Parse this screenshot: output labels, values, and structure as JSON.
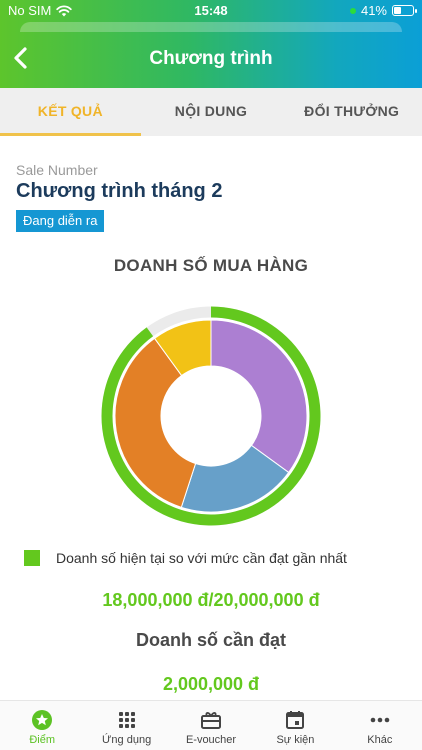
{
  "status_bar": {
    "carrier": "No SIM",
    "time": "15:48",
    "battery": "41%",
    "battery_level": 0.41,
    "icons": [
      "wifi-icon",
      "location-dot-icon",
      "battery-icon"
    ]
  },
  "header": {
    "title": "Chương trình",
    "back_icon": "chevron-left-icon"
  },
  "tabs": [
    {
      "label": "KẾT QUẢ",
      "active": true
    },
    {
      "label": "NỘI DUNG",
      "active": false
    },
    {
      "label": "ĐỔI THƯỞNG",
      "active": false
    }
  ],
  "program": {
    "subtitle": "Sale Number",
    "title": "Chương trình tháng 2",
    "status_badge": "Đang diễn ra"
  },
  "sales": {
    "section_title": "DOANH SỐ MUA HÀNG",
    "legend_label": "Doanh số hiện tại so với mức cần đạt gần nhất",
    "current_vs_target": "18,000,000 đ/20,000,000 đ",
    "target_title": "Doanh số cần đạt",
    "target_amount": "2,000,000 đ"
  },
  "chart_data": {
    "type": "pie",
    "variant": "donut",
    "slices": [
      {
        "value": 35,
        "color": "#ac7fd2"
      },
      {
        "value": 20,
        "color": "#67a0c9"
      },
      {
        "value": 35,
        "color": "#e38026"
      },
      {
        "value": 10,
        "color": "#f2c216"
      }
    ],
    "progress_ring": {
      "value": 0.9,
      "color": "#63c81e",
      "track_color": "#ebebeb"
    }
  },
  "bottom_nav": [
    {
      "label": "Điểm",
      "icon": "star-badge-icon",
      "active": true
    },
    {
      "label": "Ứng dụng",
      "icon": "grid-icon",
      "active": false
    },
    {
      "label": "E-voucher",
      "icon": "voucher-icon",
      "active": false
    },
    {
      "label": "Sự kiện",
      "icon": "calendar-icon",
      "active": false
    },
    {
      "label": "Khác",
      "icon": "more-dots-icon",
      "active": false
    }
  ],
  "colors": {
    "accent": "#63c81e",
    "tab_active": "#f0b429",
    "badge": "#1597d3",
    "title_dark": "#1c3b5c"
  }
}
